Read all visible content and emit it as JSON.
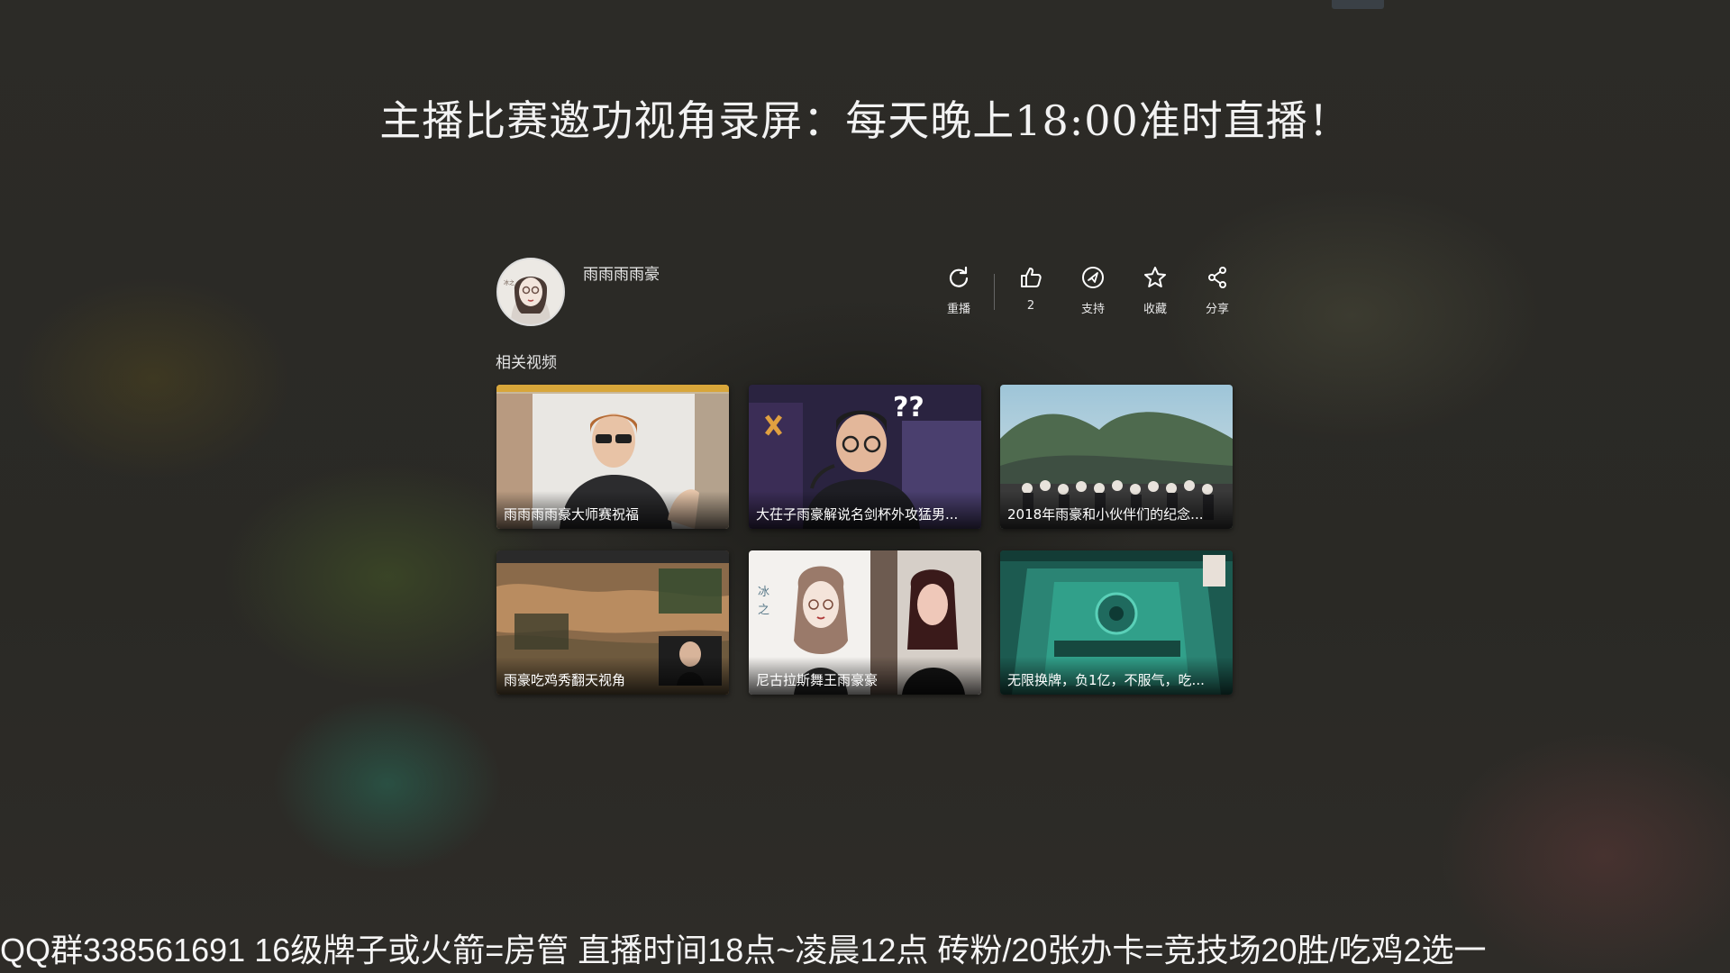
{
  "overlay": {
    "headline": "主播比赛邀功视角录屏：每天晚上18:00准时直播！",
    "ticker": "QQ群338561691 16级牌子或火箭=房管 直播时间18点~凌晨12点  砖粉/20张办卡=竞技场20胜/吃鸡2选一"
  },
  "author": {
    "name": "雨雨雨雨豪"
  },
  "actions": [
    {
      "icon": "replay-icon",
      "label": "重播"
    },
    {
      "icon": "thumbs-up-icon",
      "label": "2"
    },
    {
      "icon": "support-icon",
      "label": "支持"
    },
    {
      "icon": "star-icon",
      "label": "收藏"
    },
    {
      "icon": "share-icon",
      "label": "分享"
    }
  ],
  "related": {
    "title": "相关视频",
    "videos": [
      {
        "caption": "雨雨雨雨豪大师赛祝福"
      },
      {
        "caption": "大茌子雨豪解说名剑杯外攻猛男..."
      },
      {
        "caption": "2018年雨豪和小伙伴们的纪念..."
      },
      {
        "caption": "雨豪吃鸡秀翻天视角"
      },
      {
        "caption": "尼古拉斯舞王雨豪豪"
      },
      {
        "caption": "无限换牌，负1亿，不服气，吃..."
      }
    ]
  },
  "colors": {
    "background": "#2b2a26",
    "text": "#ffffff",
    "separator": "#666666"
  }
}
